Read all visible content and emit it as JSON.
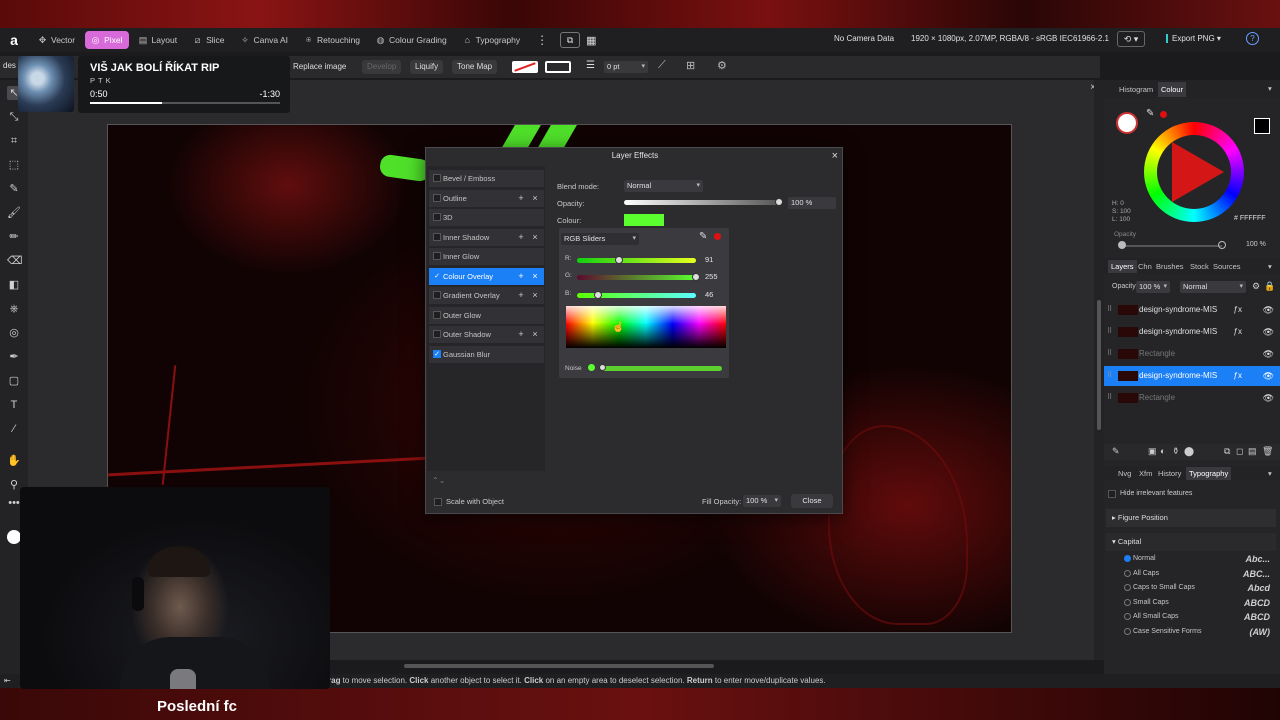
{
  "app": {
    "top_right_info": {
      "camera": "No Camera Data",
      "doc_info": "1920 × 1080px, 2.07MP, RGBA/8 - sRGB IEC61966-2.1",
      "export": "Export PNG"
    }
  },
  "personas": [
    {
      "label": "Vector",
      "icon": "vector-icon"
    },
    {
      "label": "Pixel",
      "icon": "pixel-icon",
      "active": true
    },
    {
      "label": "Layout",
      "icon": "layout-icon"
    },
    {
      "label": "Slice",
      "icon": "slice-icon"
    },
    {
      "label": "Canva AI",
      "icon": "ai-icon"
    },
    {
      "label": "Retouching",
      "icon": "retouching-icon"
    },
    {
      "label": "Colour Grading",
      "icon": "grading-icon"
    },
    {
      "label": "Typography",
      "icon": "typography-icon"
    }
  ],
  "context_toolbar": {
    "replace_image": "Replace image",
    "develop": "Develop",
    "liquify": "Liquify",
    "tone_map": "Tone Map",
    "stroke_width": "0 pt",
    "left_cut": "des"
  },
  "music": {
    "title": "VIŠ JAK BOLÍ ŘÍKAT RIP",
    "artist": "PTK",
    "elapsed": "0:50",
    "remaining": "-1:30",
    "progress": 0.38
  },
  "dialog": {
    "title": "Layer Effects",
    "effects": [
      {
        "label": "Bevel / Emboss",
        "checked": false,
        "addable": false
      },
      {
        "label": "Outline",
        "checked": false,
        "addable": true
      },
      {
        "label": "3D",
        "checked": false,
        "addable": false
      },
      {
        "label": "Inner Shadow",
        "checked": false,
        "addable": true
      },
      {
        "label": "Inner Glow",
        "checked": false,
        "addable": false
      },
      {
        "label": "Colour Overlay",
        "checked": true,
        "addable": true,
        "selected": true
      },
      {
        "label": "Gradient Overlay",
        "checked": false,
        "addable": true
      },
      {
        "label": "Outer Glow",
        "checked": false,
        "addable": false
      },
      {
        "label": "Outer Shadow",
        "checked": false,
        "addable": true
      },
      {
        "label": "Gaussian Blur",
        "checked": true,
        "addable": false
      }
    ],
    "blend_mode_label": "Blend mode:",
    "blend_mode": "Normal",
    "opacity_label": "Opacity:",
    "opacity": "100 %",
    "colour_label": "Colour:",
    "colour_hex": "#5BFF2E",
    "picker_mode": "RGB Sliders",
    "r_label": "R:",
    "g_label": "G:",
    "b_label": "B:",
    "r": "91",
    "g": "255",
    "b": "46",
    "noise_label": "Noise",
    "scale_with_object": "Scale with Object",
    "fill_opacity_label": "Fill Opacity:",
    "fill_opacity": "100 %",
    "close": "Close"
  },
  "right_panel": {
    "tabs_top": [
      "Histogram",
      "Colour"
    ],
    "colour_readout": {
      "h": "H: 0",
      "s": "S: 100",
      "l": "L: 100",
      "hex": "FFFFFF",
      "opacity_label": "Opacity",
      "opacity": "100 %"
    },
    "tabs_layers": [
      "Layers",
      "Chn",
      "Brushes",
      "Stock",
      "Sources"
    ],
    "layer_opacity_label": "Opacity:",
    "layer_opacity": "100 %",
    "layer_blend": "Normal",
    "layers": [
      {
        "name": "design-syndrome-MIS",
        "dim": false,
        "selected": false
      },
      {
        "name": "design-syndrome-MIS",
        "dim": false,
        "selected": false
      },
      {
        "name": "Rectangle",
        "dim": true,
        "selected": false
      },
      {
        "name": "design-syndrome-MIS",
        "dim": false,
        "selected": true
      },
      {
        "name": "Rectangle",
        "dim": true,
        "selected": false
      }
    ],
    "tabs_bottom": [
      "Nvg",
      "Xfm",
      "History",
      "Typography"
    ],
    "hide_irrelevant": "Hide irrelevant features",
    "figure_position": "Figure Position",
    "capital": "Capital",
    "capital_options": [
      {
        "label": "Normal",
        "preview": "Abc...",
        "on": true
      },
      {
        "label": "All Caps",
        "preview": "ABC...",
        "on": false
      },
      {
        "label": "Caps to Small Caps",
        "preview": "Abcd",
        "on": false
      },
      {
        "label": "Small Caps",
        "preview": "ABCD",
        "on": false
      },
      {
        "label": "All Small Caps",
        "preview": "ABCD",
        "on": false
      },
      {
        "label": "Case Sensitive Forms",
        "preview": "(AW)",
        "on": false
      }
    ]
  },
  "status": {
    "p1": "rag",
    "p2": " to move selection. ",
    "p3": "Click",
    "p4": " another object to select it. ",
    "p5": "Click",
    "p6": " on an empty area to deselect selection. ",
    "p7": "Return",
    "p8": " to enter move/duplicate values."
  },
  "subtitle": "Poslední fc",
  "colors": {
    "accent": "#1b7ff5",
    "pixel_persona": "#d96ad9",
    "overlay_green": "#5bff2e"
  }
}
